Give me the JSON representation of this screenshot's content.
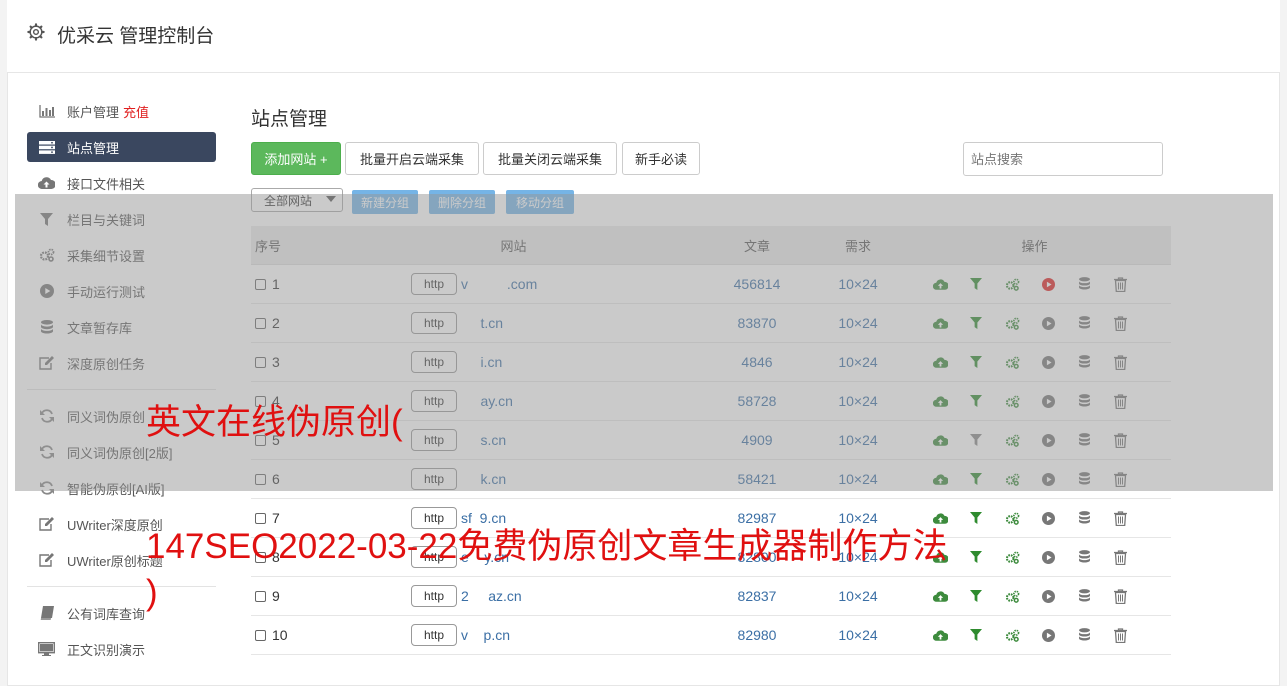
{
  "app": {
    "title": "优采云 管理控制台"
  },
  "sidebar": {
    "items": [
      {
        "label": "账户管理",
        "extra": "充值",
        "icon": "bar-chart-icon"
      },
      {
        "label": "站点管理",
        "icon": "server-icon",
        "active": true
      },
      {
        "label": "接口文件相关",
        "icon": "cloud-upload-icon"
      },
      {
        "label": "栏目与关键词",
        "icon": "filter-icon"
      },
      {
        "label": "采集细节设置",
        "icon": "gears-icon"
      },
      {
        "label": "手动运行测试",
        "icon": "play-icon"
      },
      {
        "label": "文章暂存库",
        "icon": "database-icon"
      },
      {
        "label": "深度原创任务",
        "icon": "edit-icon"
      }
    ],
    "items2": [
      {
        "label": "同义词伪原创",
        "icon": "refresh-icon"
      },
      {
        "label": "同义词伪原创[2版]",
        "icon": "refresh-icon"
      },
      {
        "label": "智能伪原创[AI版]",
        "icon": "refresh-icon"
      },
      {
        "label": "UWriter深度原创",
        "icon": "edit-icon"
      },
      {
        "label": "UWriter原创标题",
        "icon": "edit-icon"
      }
    ],
    "items3": [
      {
        "label": "公有词库查询",
        "icon": "book-icon"
      },
      {
        "label": "正文识别演示",
        "icon": "monitor-icon"
      }
    ]
  },
  "main": {
    "title": "站点管理",
    "toolbar": {
      "add_site": "添加网站 +",
      "batch_open": "批量开启云端采集",
      "batch_close": "批量关闭云端采集",
      "guide": "新手必读",
      "search_placeholder": "站点搜索"
    },
    "group_select": "全部网站",
    "group_buttons": {
      "new": "新建分组",
      "delete": "删除分组",
      "move": "移动分组"
    },
    "table": {
      "headers": {
        "no": "序号",
        "site": "网站",
        "articles": "文章",
        "demand": "需求",
        "ops": "操作"
      },
      "http_label": "http",
      "rows": [
        {
          "no": "1",
          "site": "v          .com",
          "articles": "456814",
          "demand": "10×24",
          "filter_active": true,
          "play_active": true
        },
        {
          "no": "2",
          "site": "     t.cn",
          "articles": "83870",
          "demand": "10×24",
          "filter_active": true,
          "play_active": false
        },
        {
          "no": "3",
          "site": "     i.cn",
          "articles": "4846",
          "demand": "10×24",
          "filter_active": true,
          "play_active": false
        },
        {
          "no": "4",
          "site": "     ay.cn",
          "articles": "58728",
          "demand": "10×24",
          "filter_active": true,
          "play_active": false
        },
        {
          "no": "5",
          "site": "     s.cn",
          "articles": "4909",
          "demand": "10×24",
          "filter_active": false,
          "play_active": false
        },
        {
          "no": "6",
          "site": "     k.cn",
          "articles": "58421",
          "demand": "10×24",
          "filter_active": true,
          "play_active": false
        },
        {
          "no": "7",
          "site": "sf  9.cn",
          "articles": "82987",
          "demand": "10×24",
          "filter_active": true,
          "play_active": false
        },
        {
          "no": "8",
          "site": "e    y.cn",
          "articles": "82800",
          "demand": "10×24",
          "filter_active": true,
          "play_active": false
        },
        {
          "no": "9",
          "site": "2     az.cn",
          "articles": "82837",
          "demand": "10×24",
          "filter_active": true,
          "play_active": false
        },
        {
          "no": "10",
          "site": "v    p.cn",
          "articles": "82980",
          "demand": "10×24",
          "filter_active": true,
          "play_active": false
        }
      ]
    }
  },
  "watermark": {
    "line1": "英文在线伪原创(",
    "line2": "147SEO2022-03-22免费伪原创文章生成器制作方法",
    "line3": ")"
  },
  "colors": {
    "active_nav": "#3a475f",
    "green": "#5cb85c",
    "link": "#3b6fa5",
    "watermark": "#e01010",
    "play_active": "#e02020"
  }
}
